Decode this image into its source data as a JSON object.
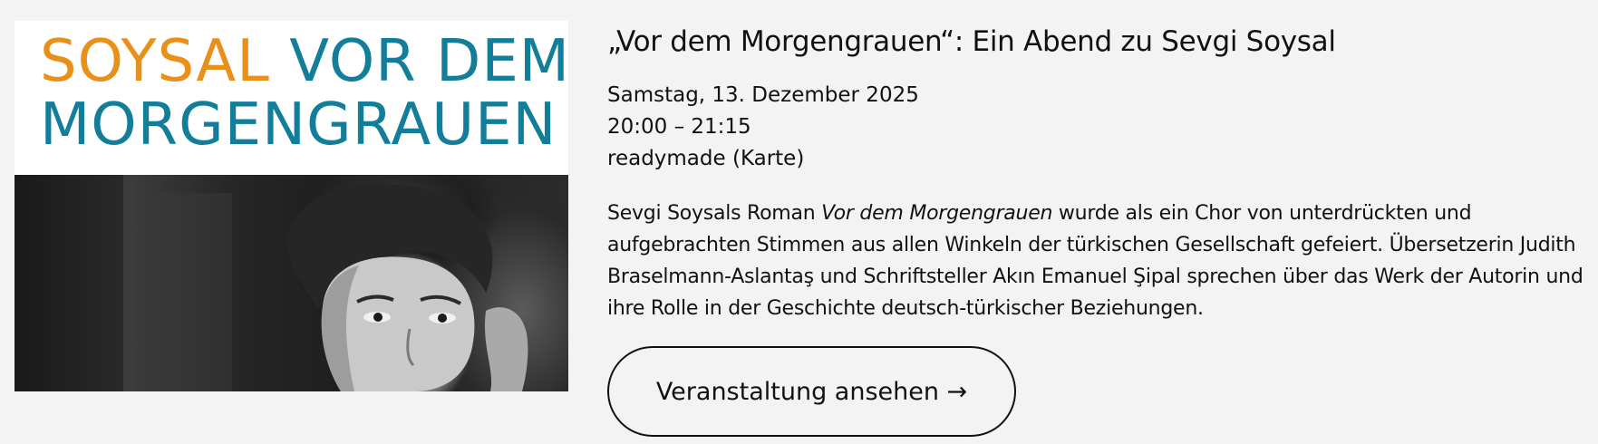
{
  "poster": {
    "title_word1": "SOYSAL",
    "title_word2": "VOR DEM",
    "title_line2": "MORGENGRAUEN",
    "colors": {
      "orange": "#e8901a",
      "teal": "#127e99"
    }
  },
  "event": {
    "title": "„Vor dem Morgengrauen“: Ein Abend zu Sevgi Soysal",
    "date": "Samstag, 13. Dezember 2025",
    "time": "20:00 – 21:15",
    "location": "readymade (Karte)",
    "description": {
      "line1_before": "Sevgi Soysals Roman ",
      "line1_italic": "Vor dem Morgengrauen",
      "line1_after": " wurde als ein Chor von unterdrückten und",
      "line2": "aufgebrachten Stimmen aus allen Winkeln der türkischen Gesellschaft gefeiert. Übersetzerin Judith",
      "line3": "Braselmann-Aslantaş und Schriftsteller Akın Emanuel Şipal sprechen über das Werk der Autorin und",
      "line4": "ihre Rolle in der Geschichte deutsch-türkischer Beziehungen."
    },
    "cta_label": "Veranstaltung ansehen →"
  }
}
